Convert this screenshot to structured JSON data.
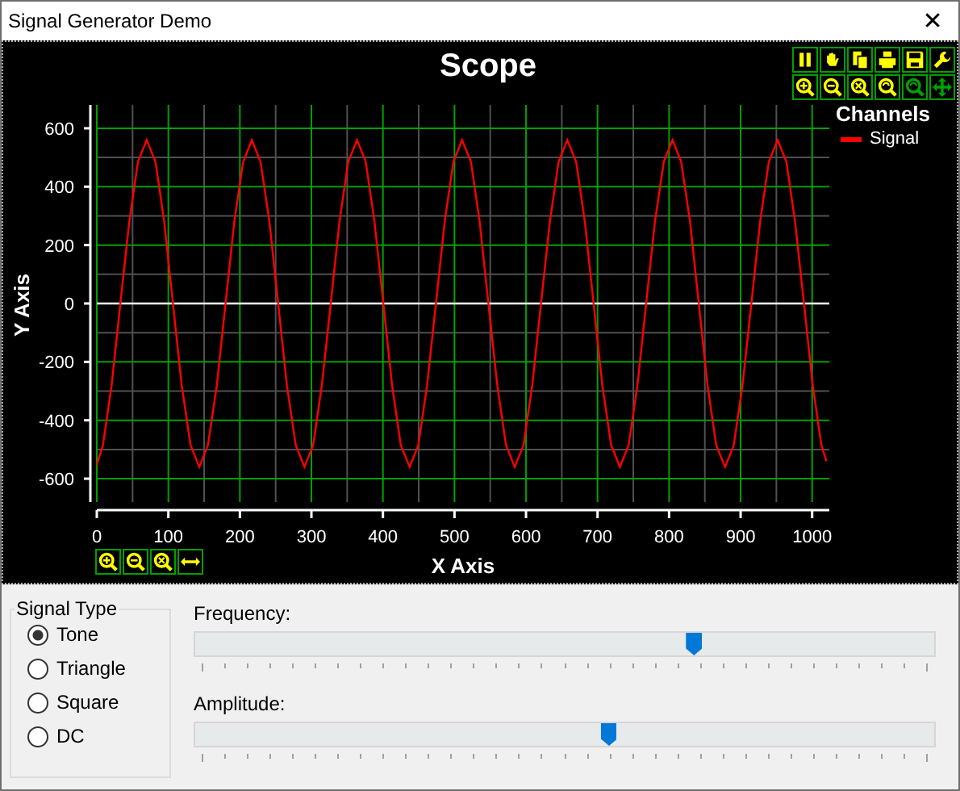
{
  "window": {
    "title": "Signal Generator Demo",
    "close": "✕"
  },
  "scope": {
    "title": "Scope",
    "toolbar": [
      {
        "kind": "pause",
        "disabled": false
      },
      {
        "kind": "hand",
        "disabled": false
      },
      {
        "kind": "copy",
        "disabled": false
      },
      {
        "kind": "print",
        "disabled": false
      },
      {
        "kind": "save",
        "disabled": false
      },
      {
        "kind": "wrench",
        "disabled": false
      },
      {
        "kind": "zoom-in",
        "disabled": false
      },
      {
        "kind": "zoom-out",
        "disabled": false
      },
      {
        "kind": "zoom-reset",
        "disabled": false
      },
      {
        "kind": "zoom-circle",
        "disabled": false
      },
      {
        "kind": "zoom-circle",
        "disabled": true
      },
      {
        "kind": "move",
        "disabled": true
      }
    ],
    "axis_toolbar": [
      {
        "kind": "zoom-in",
        "disabled": false
      },
      {
        "kind": "zoom-out",
        "disabled": false
      },
      {
        "kind": "zoom-reset",
        "disabled": false
      },
      {
        "kind": "h-move",
        "disabled": false
      }
    ],
    "legend": {
      "title": "Channels"
    },
    "chart_data": {
      "type": "line",
      "grid": true,
      "xlabel": "X Axis",
      "ylabel": "Y Axis",
      "xlim": [
        0,
        1024
      ],
      "ylim": [
        -680,
        680
      ],
      "xticks": [
        0,
        100,
        200,
        300,
        400,
        500,
        600,
        700,
        800,
        900,
        1000
      ],
      "yticks": [
        -600,
        -400,
        -200,
        0,
        200,
        400,
        600
      ],
      "x": [
        0,
        8.5,
        20.75,
        33,
        45.25,
        57.5,
        69.75,
        82,
        94.25,
        106.5,
        118.75,
        131,
        143.25,
        155.5,
        167.75,
        180,
        192.25,
        204.5,
        216.75,
        229,
        241.25,
        253.5,
        265.75,
        278,
        290.25,
        302.5,
        314.75,
        327,
        339.25,
        351.5,
        363.75,
        376,
        388.25,
        400.5,
        412.75,
        425,
        437.25,
        449.5,
        461.75,
        474,
        486.25,
        498.5,
        510.75,
        523,
        535.25,
        547.5,
        559.75,
        572,
        584.25,
        596.5,
        608.75,
        621,
        633.25,
        645.5,
        657.75,
        670,
        682.25,
        694.5,
        706.75,
        719,
        731.25,
        743.5,
        755.75,
        768,
        780.25,
        792.5,
        804.75,
        817,
        829.25,
        841.5,
        853.75,
        866,
        878.25,
        890.5,
        902.75,
        915,
        927.25,
        939.5,
        951.75,
        964,
        976.25,
        988.5,
        1000.75,
        1013,
        1020
      ],
      "series": [
        {
          "name": "Signal",
          "color": "#ff0000",
          "values": [
            -553,
            -485,
            -280,
            0,
            280,
            485,
            560,
            485,
            280,
            0,
            -280,
            -485,
            -560,
            -485,
            -280,
            0,
            280,
            485,
            560,
            485,
            280,
            0,
            -280,
            -485,
            -560,
            -485,
            -280,
            0,
            280,
            485,
            560,
            485,
            280,
            0,
            -280,
            -485,
            -560,
            -485,
            -280,
            0,
            280,
            485,
            560,
            485,
            280,
            0,
            -280,
            -485,
            -560,
            -485,
            -280,
            0,
            280,
            485,
            560,
            485,
            280,
            0,
            -280,
            -485,
            -560,
            -485,
            -280,
            0,
            280,
            485,
            560,
            485,
            280,
            0,
            -280,
            -485,
            -560,
            -485,
            -280,
            0,
            280,
            485,
            560,
            485,
            280,
            0,
            -280,
            -485,
            -540
          ]
        }
      ]
    }
  },
  "signal_type": {
    "title": "Signal Type",
    "options": [
      {
        "label": "Tone",
        "selected": true
      },
      {
        "label": "Triangle",
        "selected": false
      },
      {
        "label": "Square",
        "selected": false
      },
      {
        "label": "DC",
        "selected": false
      }
    ]
  },
  "sliders": [
    {
      "label": "Frequency:",
      "level": 0.675
    },
    {
      "label": "Amplitude:",
      "level": 0.56
    }
  ]
}
